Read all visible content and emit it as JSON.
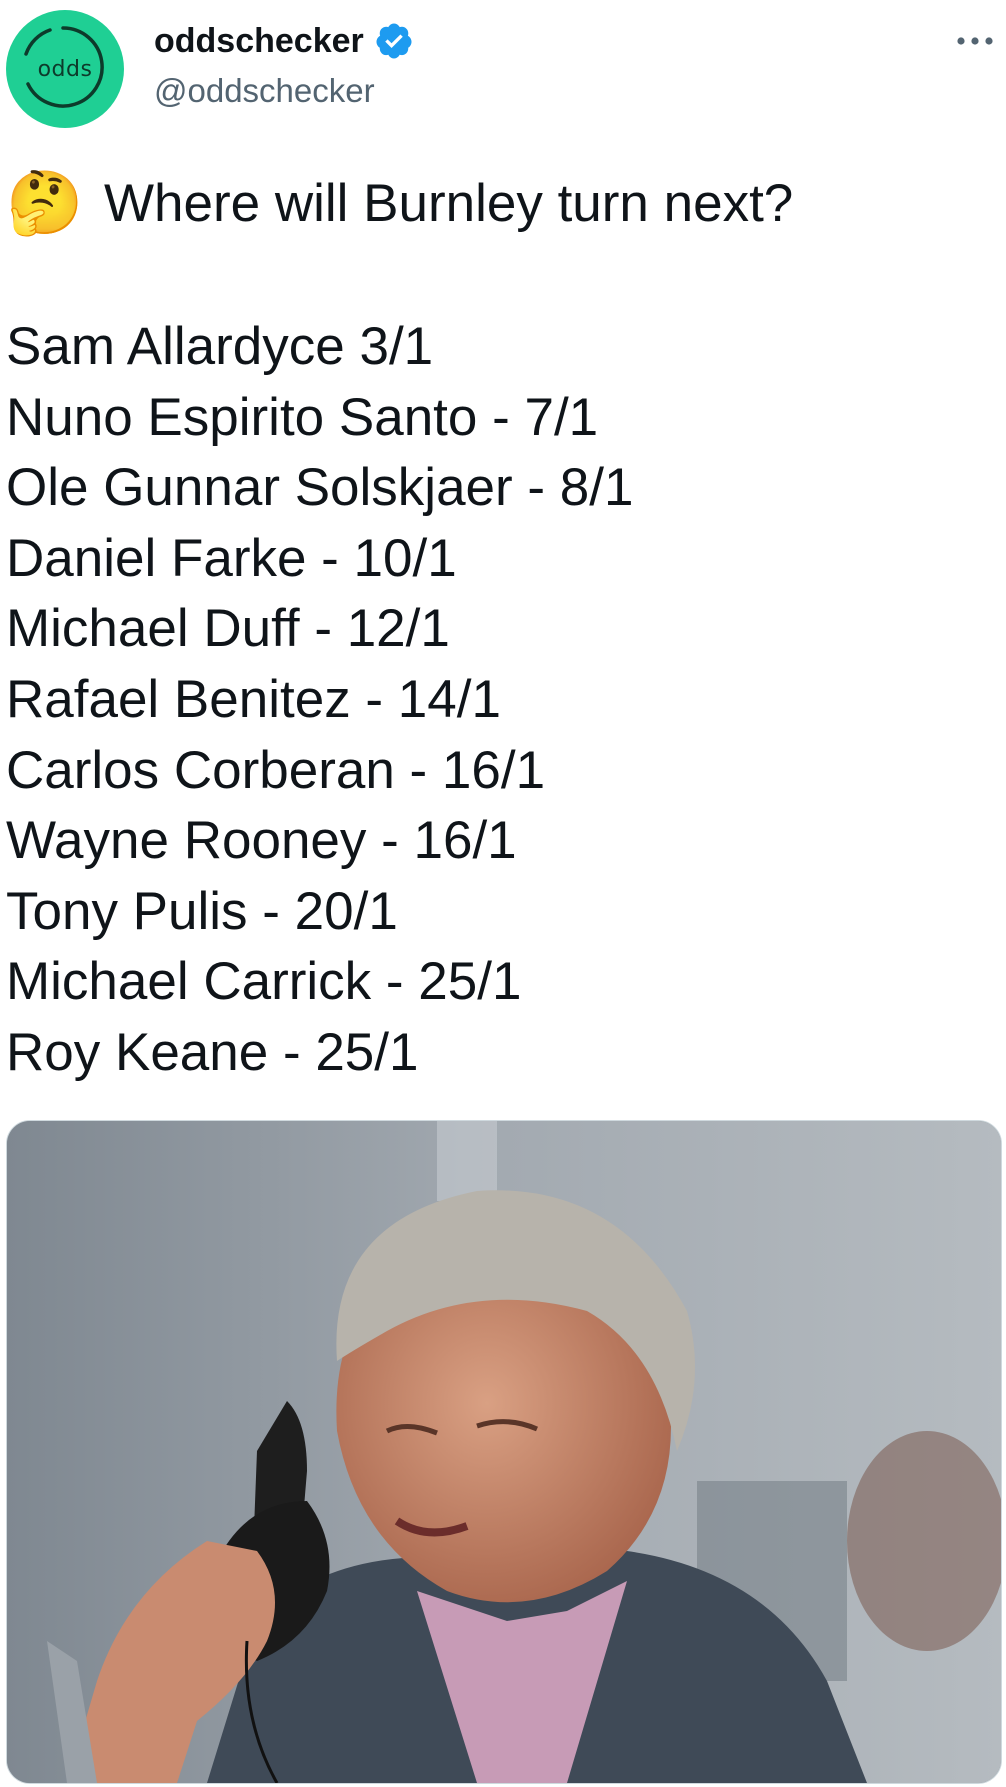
{
  "account": {
    "display_name": "oddschecker",
    "handle": "@oddschecker",
    "avatar_text": "odds",
    "verified_icon": "verified-badge-icon",
    "brand_color": "#1fcf94",
    "verified_color": "#1d9bf0"
  },
  "tweet": {
    "emoji": "🤔",
    "question": "Where will Burnley turn next?",
    "odds": [
      "Sam Allardyce 3/1",
      "Nuno Espirito Santo - 7/1",
      "Ole Gunnar Solskjaer - 8/1",
      "Daniel Farke - 10/1",
      "Michael Duff - 12/1",
      "Rafael Benitez - 14/1",
      "Carlos Corberan - 16/1",
      "Wayne Rooney - 16/1",
      "Tony Pulis - 20/1",
      "Michael Carrick - 25/1",
      "Roy Keane - 25/1"
    ]
  },
  "media": {
    "icon": "photo-of-man-on-phone"
  },
  "menu_icon": "more-options-icon"
}
